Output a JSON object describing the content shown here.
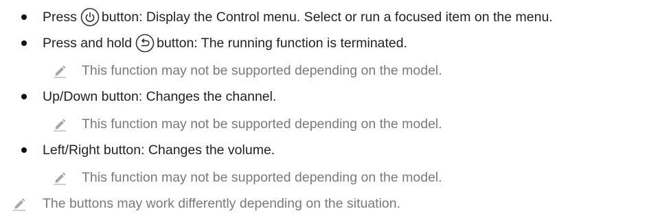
{
  "items": [
    {
      "kind": "bullet",
      "pre": "Press",
      "icon": "power-icon",
      "post": "button: Display the Control menu. Select or run a focused item on the menu."
    },
    {
      "kind": "bullet",
      "pre": "Press and hold",
      "icon": "return-icon",
      "post": "button: The running function is terminated."
    },
    {
      "kind": "note",
      "icon": "pencil-note-icon",
      "text": "This function may not be supported depending on the model."
    },
    {
      "kind": "bullet",
      "text": "Up/Down button: Changes the channel."
    },
    {
      "kind": "note",
      "icon": "pencil-note-icon",
      "text": "This function may not be supported depending on the model."
    },
    {
      "kind": "bullet",
      "text": "Left/Right button: Changes the volume."
    },
    {
      "kind": "note",
      "icon": "pencil-note-icon",
      "text": "This function may not be supported depending on the model."
    },
    {
      "kind": "note",
      "icon": "pencil-note-icon",
      "text": "The buttons may work differently depending on the situation."
    }
  ]
}
